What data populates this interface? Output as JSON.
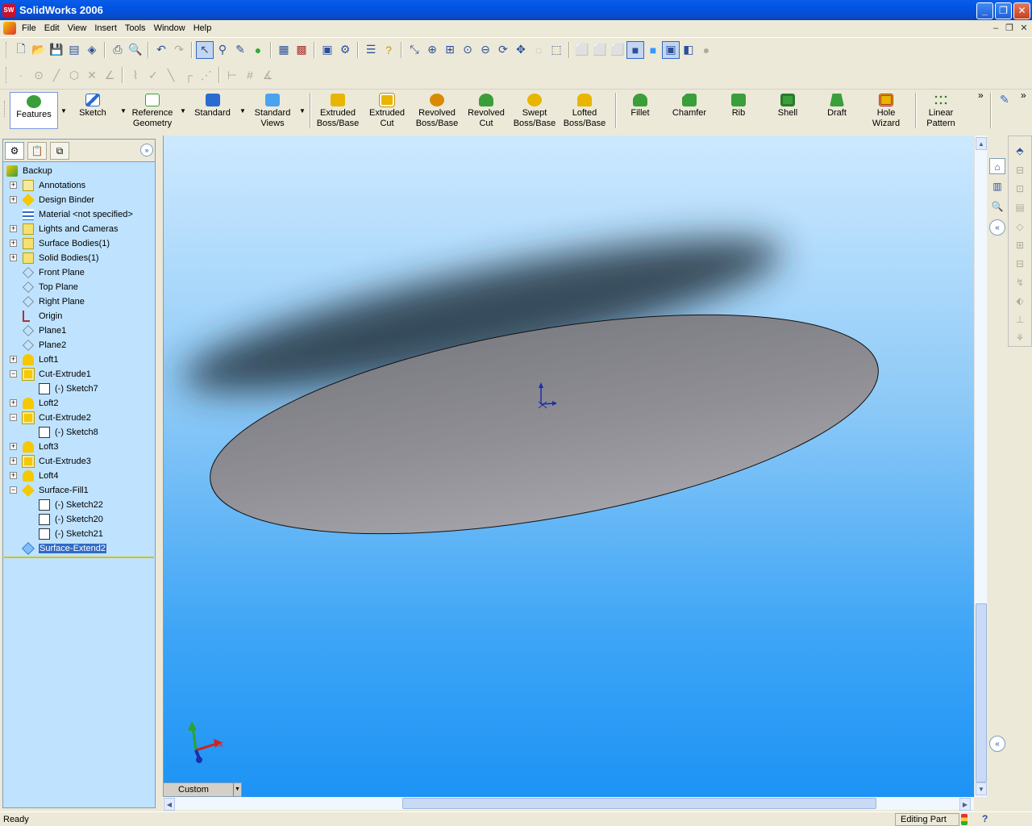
{
  "window": {
    "title": "SolidWorks 2006",
    "logo": "SW",
    "controls": {
      "minimize": "_",
      "maximize": "❐",
      "close": "✕"
    }
  },
  "menu": {
    "items": [
      "File",
      "Edit",
      "View",
      "Insert",
      "Tools",
      "Window",
      "Help"
    ],
    "mdi": {
      "minimize": "–",
      "restore": "❐",
      "close": "✕"
    }
  },
  "command_manager": {
    "buttons": [
      {
        "name": "features",
        "label": "Features",
        "icon": "features-icon"
      },
      {
        "name": "sketch",
        "label": "Sketch",
        "icon": "sketch-icon"
      },
      {
        "name": "reference-geometry",
        "label": "Reference Geometry",
        "icon": "reference-geometry-icon"
      },
      {
        "name": "standard",
        "label": "Standard",
        "icon": "standard-icon"
      },
      {
        "name": "standard-views",
        "label": "Standard Views",
        "icon": "standard-views-icon"
      },
      {
        "name": "extruded-boss-base",
        "label": "Extruded Boss/Base",
        "icon": "extruded-boss-icon"
      },
      {
        "name": "extruded-cut",
        "label": "Extruded Cut",
        "icon": "extruded-cut-icon"
      },
      {
        "name": "revolved-boss-base",
        "label": "Revolved Boss/Base",
        "icon": "revolved-boss-icon"
      },
      {
        "name": "revolved-cut",
        "label": "Revolved Cut",
        "icon": "revolved-cut-icon"
      },
      {
        "name": "swept-boss-base",
        "label": "Swept Boss/Base",
        "icon": "swept-boss-icon"
      },
      {
        "name": "lofted-boss-base",
        "label": "Lofted Boss/Base",
        "icon": "lofted-boss-icon"
      },
      {
        "name": "fillet",
        "label": "Fillet",
        "icon": "fillet-icon"
      },
      {
        "name": "chamfer",
        "label": "Chamfer",
        "icon": "chamfer-icon"
      },
      {
        "name": "rib",
        "label": "Rib",
        "icon": "rib-icon"
      },
      {
        "name": "shell",
        "label": "Shell",
        "icon": "shell-icon"
      },
      {
        "name": "draft",
        "label": "Draft",
        "icon": "draft-icon"
      },
      {
        "name": "hole-wizard",
        "label": "Hole Wizard",
        "icon": "hole-wizard-icon"
      },
      {
        "name": "linear-pattern",
        "label": "Linear Pattern",
        "icon": "linear-pattern-icon"
      }
    ],
    "more": "»"
  },
  "feature_tree": {
    "root": "Backup",
    "items": [
      {
        "label": "Annotations",
        "icon": "annotations-icon",
        "expander": "+"
      },
      {
        "label": "Design Binder",
        "icon": "design-binder-icon",
        "expander": "+"
      },
      {
        "label": "Material <not specified>",
        "icon": "material-icon",
        "expander": ""
      },
      {
        "label": "Lights and Cameras",
        "icon": "lights-icon",
        "expander": "+"
      },
      {
        "label": "Surface Bodies(1)",
        "icon": "surface-bodies-icon",
        "expander": "+"
      },
      {
        "label": "Solid Bodies(1)",
        "icon": "solid-bodies-icon",
        "expander": "+"
      },
      {
        "label": "Front Plane",
        "icon": "plane-icon",
        "expander": ""
      },
      {
        "label": "Top Plane",
        "icon": "plane-icon",
        "expander": ""
      },
      {
        "label": "Right Plane",
        "icon": "plane-icon",
        "expander": ""
      },
      {
        "label": "Origin",
        "icon": "origin-icon",
        "expander": ""
      },
      {
        "label": "Plane1",
        "icon": "plane-icon",
        "expander": ""
      },
      {
        "label": "Plane2",
        "icon": "plane-icon",
        "expander": ""
      },
      {
        "label": "Loft1",
        "icon": "loft-icon",
        "expander": "+"
      },
      {
        "label": "Cut-Extrude1",
        "icon": "cut-extrude-icon",
        "expander": "−"
      },
      {
        "label": "(-) Sketch7",
        "icon": "sketch-icon",
        "expander": ""
      },
      {
        "label": "Loft2",
        "icon": "loft-icon",
        "expander": "+"
      },
      {
        "label": "Cut-Extrude2",
        "icon": "cut-extrude-icon",
        "expander": "−"
      },
      {
        "label": "(-) Sketch8",
        "icon": "sketch-icon",
        "expander": ""
      },
      {
        "label": "Loft3",
        "icon": "loft-icon",
        "expander": "+"
      },
      {
        "label": "Cut-Extrude3",
        "icon": "cut-extrude-icon",
        "expander": "+"
      },
      {
        "label": "Loft4",
        "icon": "loft-icon",
        "expander": "+"
      },
      {
        "label": "Surface-Fill1",
        "icon": "surface-fill-icon",
        "expander": "−"
      },
      {
        "label": "(-) Sketch22",
        "icon": "sketch-icon",
        "expander": ""
      },
      {
        "label": "(-) Sketch20",
        "icon": "sketch-icon",
        "expander": ""
      },
      {
        "label": "(-) Sketch21",
        "icon": "sketch-icon",
        "expander": ""
      },
      {
        "label": "Surface-Extend2",
        "icon": "surface-extend-icon",
        "expander": "",
        "selected": true
      }
    ]
  },
  "graphics": {
    "view_orientation": "Custom",
    "triad_x": "X"
  },
  "status": {
    "text": "Ready",
    "mode": "Editing Part",
    "help": "?"
  },
  "colors": {
    "title_bar": "#0054e3",
    "selection": "#316ac5",
    "viewport_bottom": "#1c93f5",
    "part_surface": "#8f8f95"
  }
}
